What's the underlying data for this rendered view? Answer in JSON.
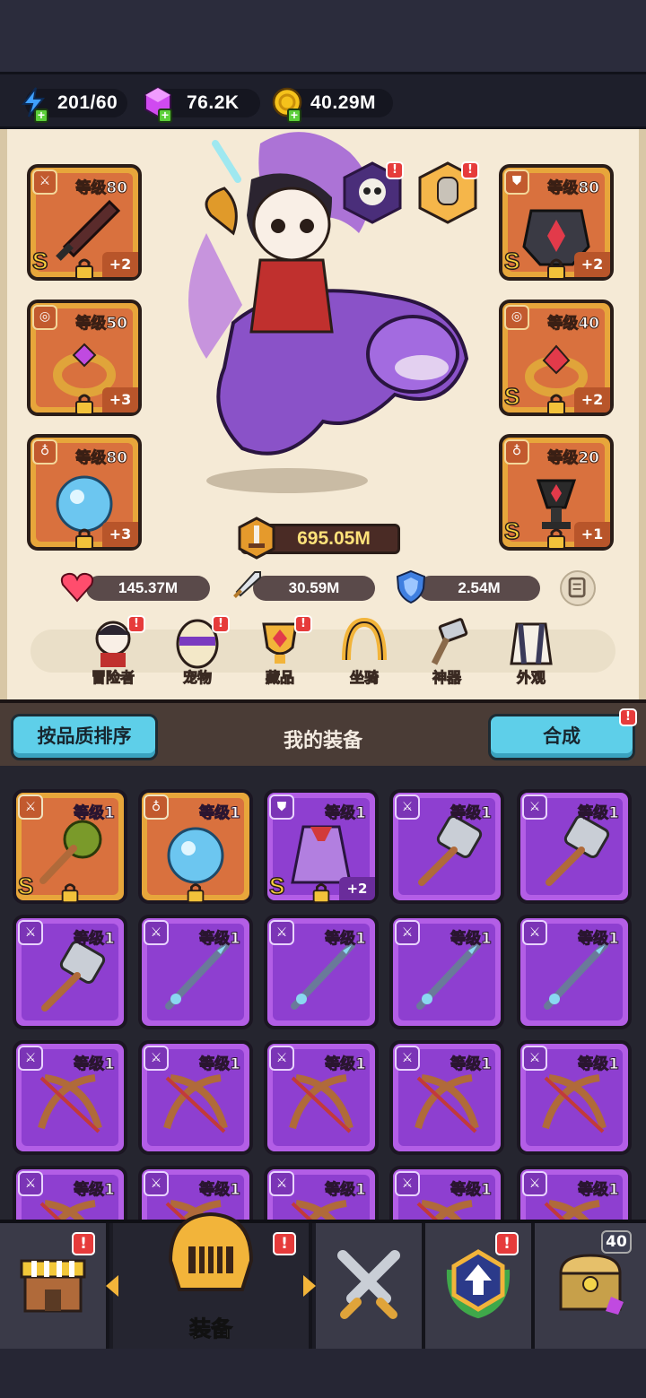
{
  "resources": {
    "energy": "201/60",
    "gems": "76.2K",
    "gold": "40.29M"
  },
  "equipped": {
    "left": [
      {
        "type": "weapon",
        "level": "等级80",
        "grade": "S",
        "bonus": "+2"
      },
      {
        "type": "ring",
        "level": "等级50",
        "grade": "",
        "bonus": "+3"
      },
      {
        "type": "necklace",
        "level": "等级80",
        "grade": "",
        "bonus": "+3"
      }
    ],
    "right": [
      {
        "type": "armor",
        "level": "等级80",
        "grade": "S",
        "bonus": "+2"
      },
      {
        "type": "ring",
        "level": "等级40",
        "grade": "S",
        "bonus": "+2"
      },
      {
        "type": "necklace",
        "level": "等级20",
        "grade": "S",
        "bonus": "+1"
      }
    ]
  },
  "power": "695.05M",
  "stats": {
    "hp": "145.37M",
    "attack": "30.59M",
    "defense": "2.54M"
  },
  "menu": [
    {
      "label": "冒险者",
      "alert": "!"
    },
    {
      "label": "宠物",
      "alert": "!"
    },
    {
      "label": "藏品",
      "alert": "!"
    },
    {
      "label": "坐骑",
      "alert": ""
    },
    {
      "label": "神器",
      "alert": ""
    },
    {
      "label": "外观",
      "alert": ""
    }
  ],
  "equipment_header": {
    "sort_button": "按品质排序",
    "title": "我的装备",
    "merge_button": "合成",
    "merge_alert": "!"
  },
  "inventory": [
    {
      "rarity": "orange",
      "art": "mace",
      "level": "等级1",
      "grade": "S",
      "bonus": ""
    },
    {
      "rarity": "orange",
      "art": "orb",
      "level": "等级1",
      "grade": "",
      "bonus": ""
    },
    {
      "rarity": "purple",
      "art": "cape",
      "level": "等级1",
      "grade": "S",
      "bonus": "+2"
    },
    {
      "rarity": "purple",
      "art": "hammer",
      "level": "等级1",
      "grade": "",
      "bonus": ""
    },
    {
      "rarity": "purple",
      "art": "hammer",
      "level": "等级1",
      "grade": "",
      "bonus": ""
    },
    {
      "rarity": "purple",
      "art": "hammer",
      "level": "等级1",
      "grade": "",
      "bonus": ""
    },
    {
      "rarity": "purple",
      "art": "spear",
      "level": "等级1",
      "grade": "",
      "bonus": ""
    },
    {
      "rarity": "purple",
      "art": "spear",
      "level": "等级1",
      "grade": "",
      "bonus": ""
    },
    {
      "rarity": "purple",
      "art": "spear",
      "level": "等级1",
      "grade": "",
      "bonus": ""
    },
    {
      "rarity": "purple",
      "art": "spear",
      "level": "等级1",
      "grade": "",
      "bonus": ""
    },
    {
      "rarity": "purple",
      "art": "bow",
      "level": "等级1",
      "grade": "",
      "bonus": ""
    },
    {
      "rarity": "purple",
      "art": "bow",
      "level": "等级1",
      "grade": "",
      "bonus": ""
    },
    {
      "rarity": "purple",
      "art": "bow",
      "level": "等级1",
      "grade": "",
      "bonus": ""
    },
    {
      "rarity": "purple",
      "art": "bow",
      "level": "等级1",
      "grade": "",
      "bonus": ""
    },
    {
      "rarity": "purple",
      "art": "bow",
      "level": "等级1",
      "grade": "",
      "bonus": ""
    },
    {
      "rarity": "purple",
      "art": "bow",
      "level": "等级1",
      "grade": "",
      "bonus": ""
    },
    {
      "rarity": "purple",
      "art": "bow",
      "level": "等级1",
      "grade": "",
      "bonus": ""
    },
    {
      "rarity": "purple",
      "art": "bow",
      "level": "等级1",
      "grade": "",
      "bonus": ""
    },
    {
      "rarity": "purple",
      "art": "bow",
      "level": "等级1",
      "grade": "",
      "bonus": ""
    },
    {
      "rarity": "purple",
      "art": "bow",
      "level": "等级1",
      "grade": "",
      "bonus": ""
    }
  ],
  "bottom_nav": {
    "shop_alert": "!",
    "equip_label": "装备",
    "equip_alert": "!",
    "upgrade_alert": "!",
    "chest_count": "40"
  },
  "colors": {
    "orange_rarity": "#e7a63b",
    "purple_rarity": "#b35ee6",
    "accent_cyan": "#5ecfe9",
    "alert_red": "#e63b3b"
  }
}
